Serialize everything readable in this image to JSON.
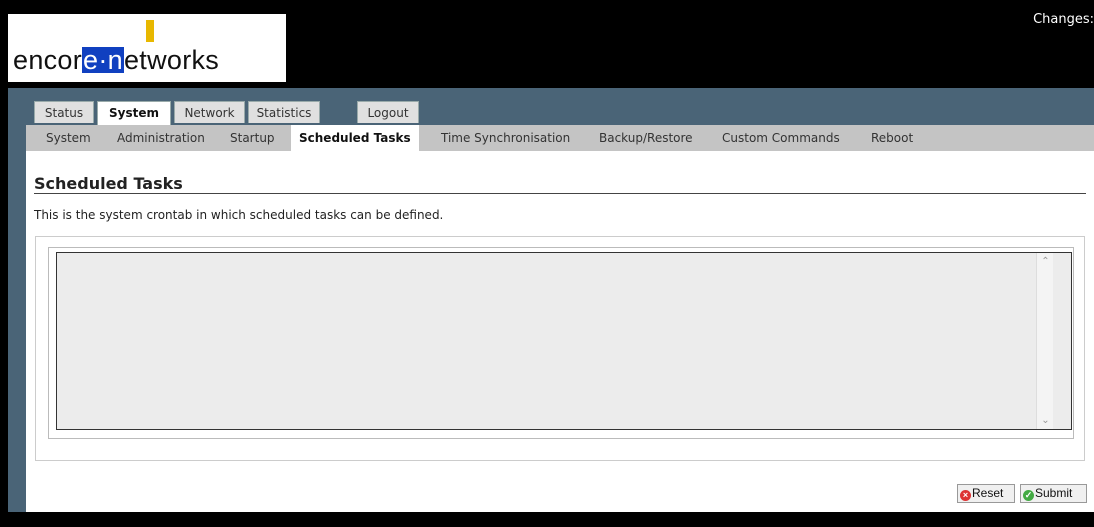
{
  "header": {
    "logo_prefix": "encor",
    "logo_highlight": "e·n",
    "logo_suffix": "etworks",
    "changes_label": "Changes:"
  },
  "tabs": [
    {
      "label": "Status",
      "active": false
    },
    {
      "label": "System",
      "active": true
    },
    {
      "label": "Network",
      "active": false
    },
    {
      "label": "Statistics",
      "active": false
    },
    {
      "label": "Logout",
      "active": false
    }
  ],
  "subnav": [
    {
      "label": "System",
      "active": false
    },
    {
      "label": "Administration",
      "active": false
    },
    {
      "label": "Startup",
      "active": false
    },
    {
      "label": "Scheduled Tasks",
      "active": true
    },
    {
      "label": "Time Synchronisation",
      "active": false
    },
    {
      "label": "Backup/Restore",
      "active": false
    },
    {
      "label": "Custom Commands",
      "active": false
    },
    {
      "label": "Reboot",
      "active": false
    }
  ],
  "page": {
    "title": "Scheduled Tasks",
    "description": "This is the system crontab in which scheduled tasks can be defined.",
    "crontab_value": ""
  },
  "actions": {
    "reset_label": "Reset",
    "submit_label": "Submit"
  },
  "icons": {
    "reset": "reset-icon",
    "submit": "submit-icon",
    "scroll_up": "scroll-up-icon",
    "scroll_down": "scroll-down-icon"
  },
  "colors": {
    "band": "#4a6477",
    "subnav": "#c4c4c4",
    "logo_blue": "#1040c0",
    "logo_yellow": "#e8b800"
  }
}
